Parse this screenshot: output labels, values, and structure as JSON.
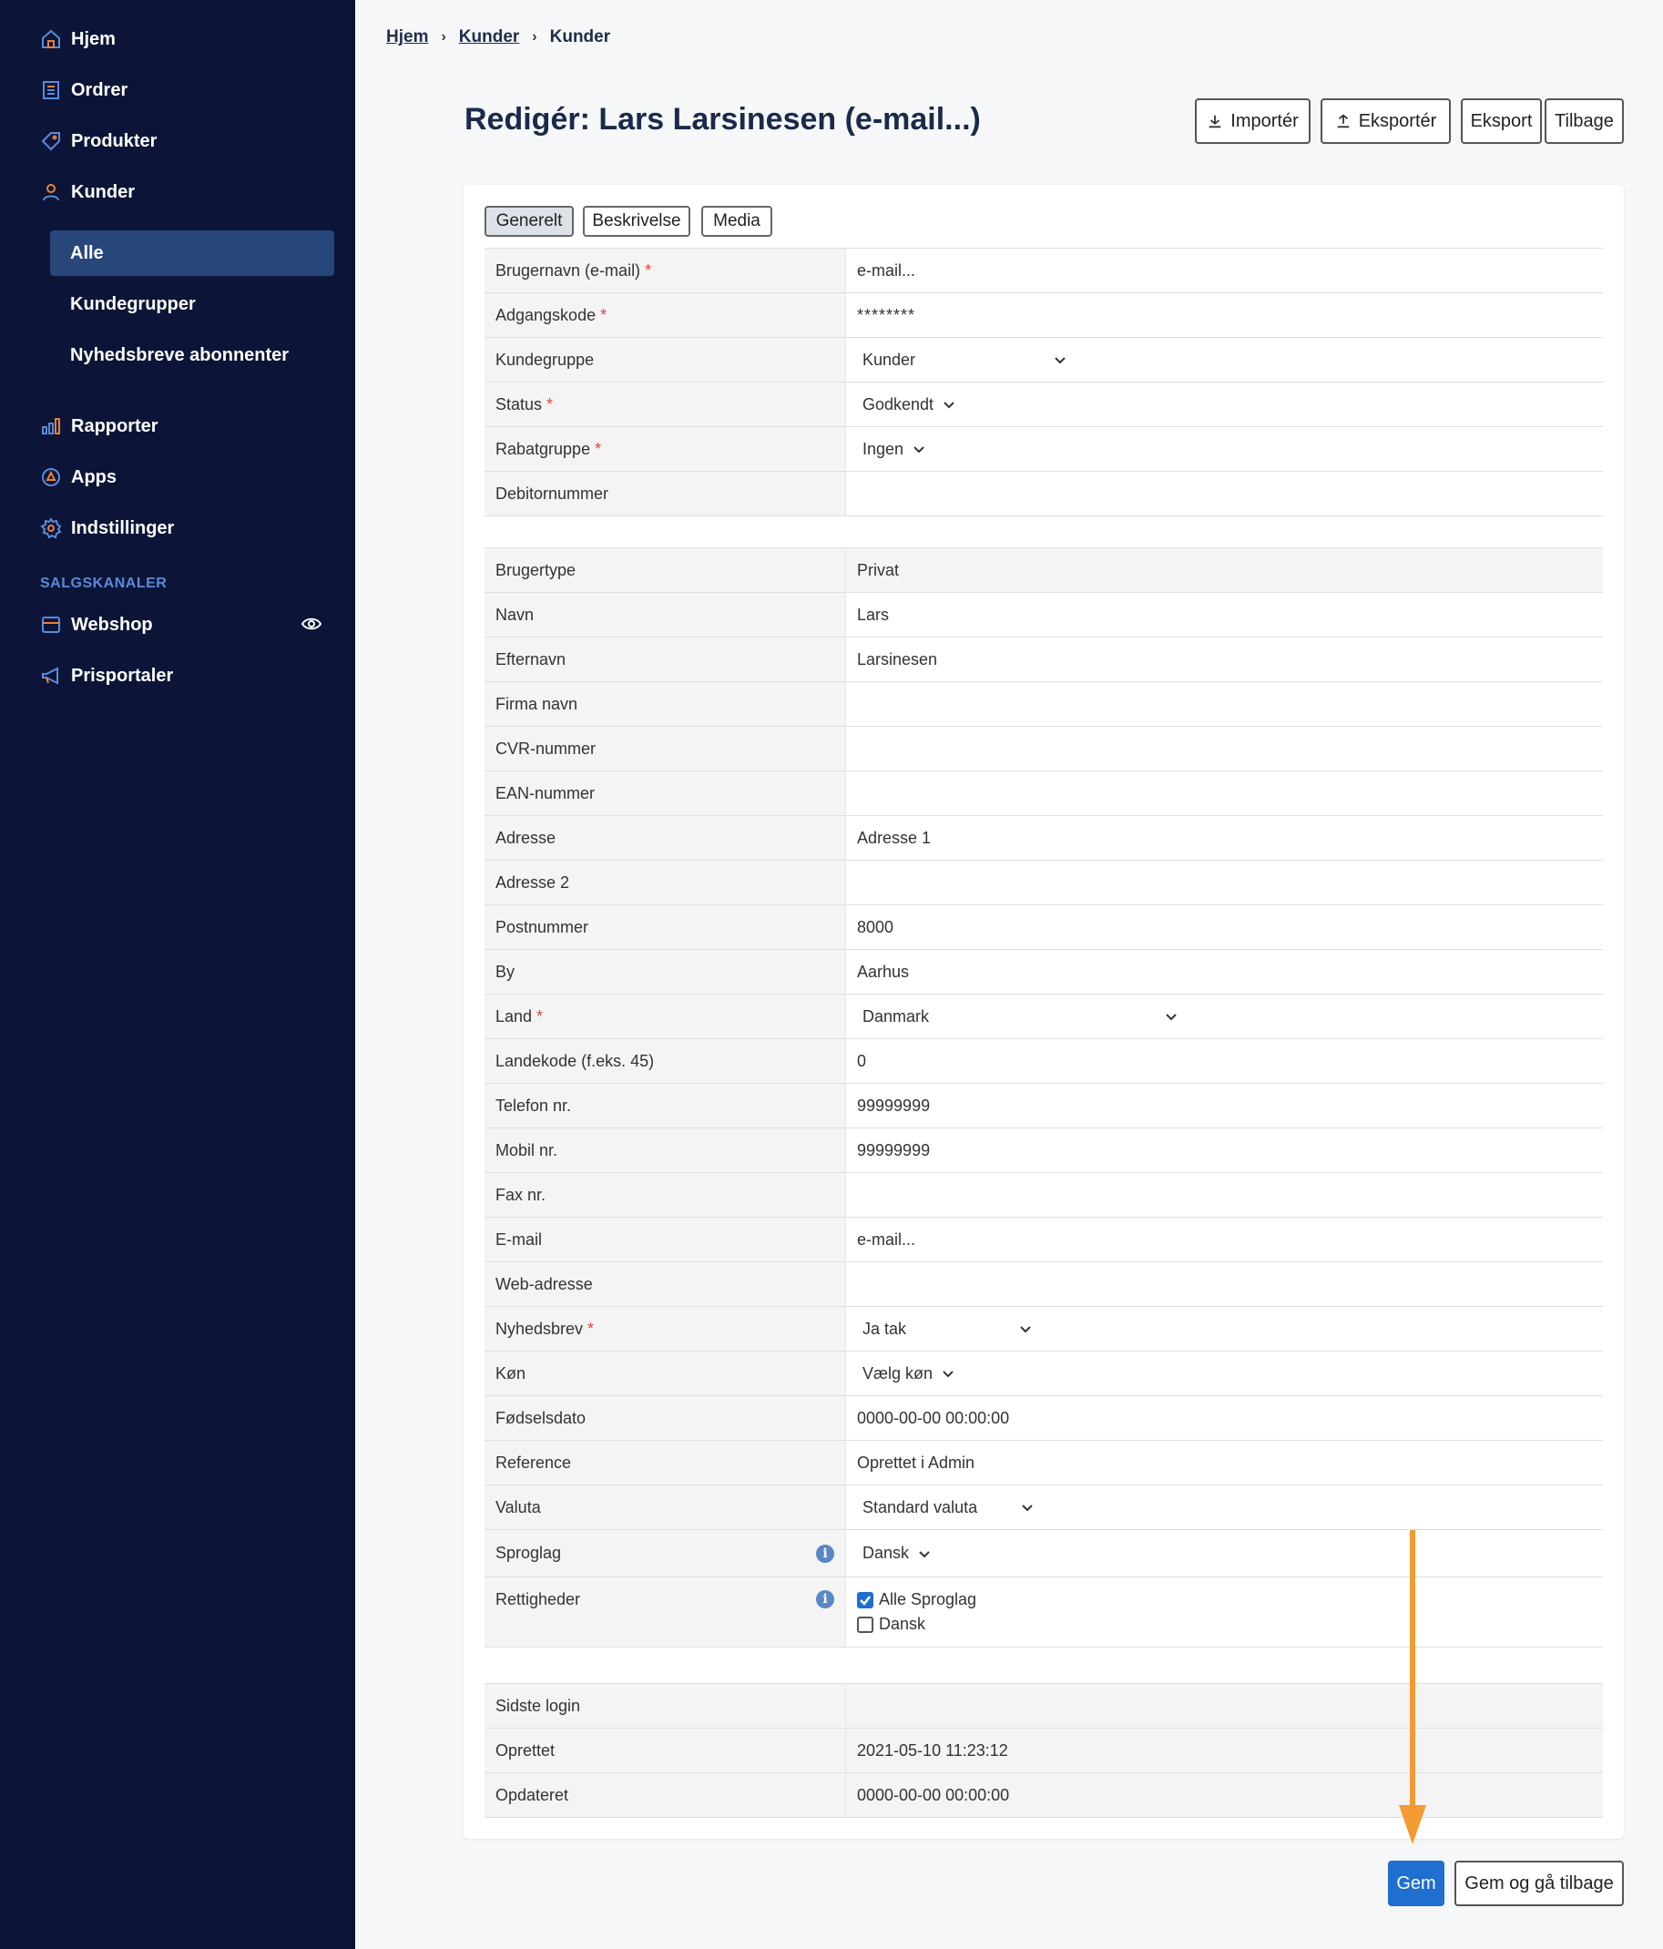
{
  "sidebar": {
    "items": [
      {
        "label": "Hjem",
        "icon": "home-icon"
      },
      {
        "label": "Ordrer",
        "icon": "orders-icon"
      },
      {
        "label": "Produkter",
        "icon": "tag-icon"
      },
      {
        "label": "Kunder",
        "icon": "user-icon"
      },
      {
        "label": "Rapporter",
        "icon": "bar-chart-icon"
      },
      {
        "label": "Apps",
        "icon": "apps-icon"
      },
      {
        "label": "Indstillinger",
        "icon": "gear-icon"
      }
    ],
    "sub_items": [
      {
        "label": "Alle",
        "active": true
      },
      {
        "label": "Kundegrupper"
      },
      {
        "label": "Nyhedsbreve abonnenter"
      }
    ],
    "section_label": "SALGSKANALER",
    "channels": [
      {
        "label": "Webshop",
        "icon": "store-icon"
      },
      {
        "label": "Prisportaler",
        "icon": "megaphone-icon"
      }
    ],
    "colors": {
      "background": "#0c1537",
      "active": "#27477a",
      "icon": "#5b8ad8",
      "accent": "#e8823a"
    }
  },
  "breadcrumb": [
    "Hjem",
    "Kunder",
    "Kunder"
  ],
  "page_title": "Redigér: Lars Larsinesen (e-mail...)",
  "toolbar": {
    "import_label": "Importér",
    "export_label": "Eksportér",
    "export2_label": "Eksport",
    "back_label": "Tilbage"
  },
  "tabs": [
    "Generelt",
    "Beskrivelse",
    "Media"
  ],
  "section1": [
    {
      "label": "Brugernavn (e-mail)",
      "required": "*",
      "value": "e-mail..."
    },
    {
      "label": "Adgangskode",
      "required": "*",
      "value": "********"
    },
    {
      "label": "Kundegruppe",
      "value": "Kunder"
    },
    {
      "label": "Status",
      "required": "*",
      "value": "Godkendt"
    },
    {
      "label": "Rabatgruppe",
      "required": "*",
      "value": "Ingen"
    },
    {
      "label": "Debitornummer",
      "value": ""
    }
  ],
  "section2": [
    {
      "label": "Brugertype",
      "value": "Privat"
    },
    {
      "label": "Navn",
      "value": "Lars"
    },
    {
      "label": "Efternavn",
      "value": "Larsinesen"
    },
    {
      "label": "Firma navn",
      "value": ""
    },
    {
      "label": "CVR-nummer",
      "value": ""
    },
    {
      "label": "EAN-nummer",
      "value": ""
    },
    {
      "label": "Adresse",
      "value": "Adresse 1"
    },
    {
      "label": "Adresse 2",
      "value": ""
    },
    {
      "label": "Postnummer",
      "value": "8000"
    },
    {
      "label": "By",
      "value": "Aarhus"
    },
    {
      "label": "Land",
      "required": "*",
      "value": "Danmark"
    },
    {
      "label": "Landekode (f.eks. 45)",
      "value": "0"
    },
    {
      "label": "Telefon nr.",
      "value": "99999999"
    },
    {
      "label": "Mobil nr.",
      "value": "99999999"
    },
    {
      "label": "Fax nr.",
      "value": ""
    },
    {
      "label": "E-mail",
      "value": "e-mail..."
    },
    {
      "label": "Web-adresse",
      "value": ""
    },
    {
      "label": "Nyhedsbrev",
      "required": "*",
      "value": "Ja tak"
    },
    {
      "label": "Køn",
      "value": "Vælg køn"
    },
    {
      "label": "Fødselsdato",
      "value": "0000-00-00 00:00:00"
    },
    {
      "label": "Reference",
      "value": "Oprettet i Admin"
    },
    {
      "label": "Valuta",
      "value": "Standard valuta"
    },
    {
      "label": "Sproglag",
      "value": "Dansk",
      "info": "i"
    },
    {
      "label": "Rettigheder",
      "info": "i",
      "options": [
        {
          "label": "Alle Sproglag",
          "checked": true
        },
        {
          "label": "Dansk",
          "checked": false
        }
      ]
    }
  ],
  "section3": [
    {
      "label": "Sidste login",
      "value": ""
    },
    {
      "label": "Oprettet",
      "value": "2021-05-10 11:23:12"
    },
    {
      "label": "Opdateret",
      "value": "0000-00-00 00:00:00"
    }
  ],
  "footer": {
    "save_label": "Gem",
    "save_back_label": "Gem og gå tilbage"
  },
  "colors": {
    "primary": "#1f6fd1",
    "required": "#e0453b",
    "annotation_arrow": "#f39a33"
  }
}
